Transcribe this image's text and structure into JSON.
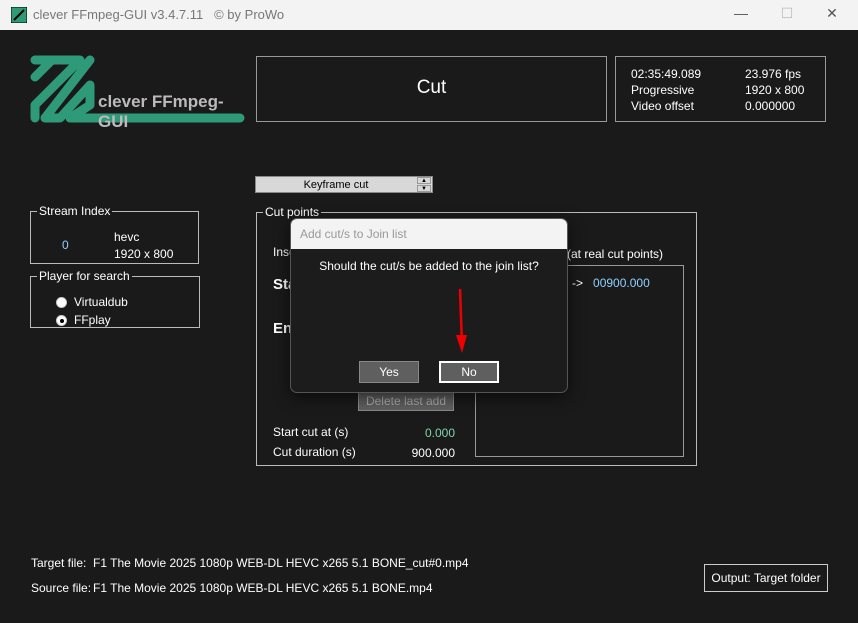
{
  "window": {
    "title": "clever FFmpeg-GUI v3.4.7.11",
    "copyright": "© by ProWo",
    "minimize": "—",
    "maximize": "☐",
    "close": "✕"
  },
  "logo": {
    "text": "clever FFmpeg-GUI"
  },
  "mode_title": "Cut",
  "info": {
    "duration": "02:35:49.089",
    "fps": "23.976 fps",
    "scan": "Progressive",
    "resolution": "1920 x 800",
    "offset_label": "Video offset",
    "offset_value": "0.000000"
  },
  "cut_mode": {
    "selected": "Keyframe cut"
  },
  "stream_index": {
    "legend": "Stream Index",
    "index": "0",
    "codec": "hevc",
    "resolution": "1920 x 800"
  },
  "player": {
    "legend": "Player for search",
    "options": [
      {
        "label": "Virtualdub",
        "selected": false
      },
      {
        "label": "FFplay",
        "selected": true
      }
    ]
  },
  "cut_points": {
    "legend": "Cut points",
    "insert_label": "Inse",
    "start_label": "Sta",
    "end_label": "En",
    "delete_button": "Delete last add",
    "right_header": "(at real cut points)",
    "list_entry_arrow": "->",
    "list_entry_value": "00900.000",
    "start_cut_label": "Start cut at (s)",
    "start_cut_value": "0.000",
    "duration_label": "Cut duration (s)",
    "duration_value": "900.000"
  },
  "dialog": {
    "title": "Add cut/s to Join list",
    "message": "Should the cut/s be added to the join list?",
    "yes": "Yes",
    "no": "No"
  },
  "files": {
    "target_label": "Target file:",
    "target_value": "F1 The Movie 2025 1080p WEB-DL HEVC x265 5.1 BONE_cut#0.mp4",
    "source_label": "Source file:",
    "source_value": "F1 The Movie 2025 1080p WEB-DL HEVC x265 5.1 BONE.mp4"
  },
  "output_button": "Output: Target folder"
}
